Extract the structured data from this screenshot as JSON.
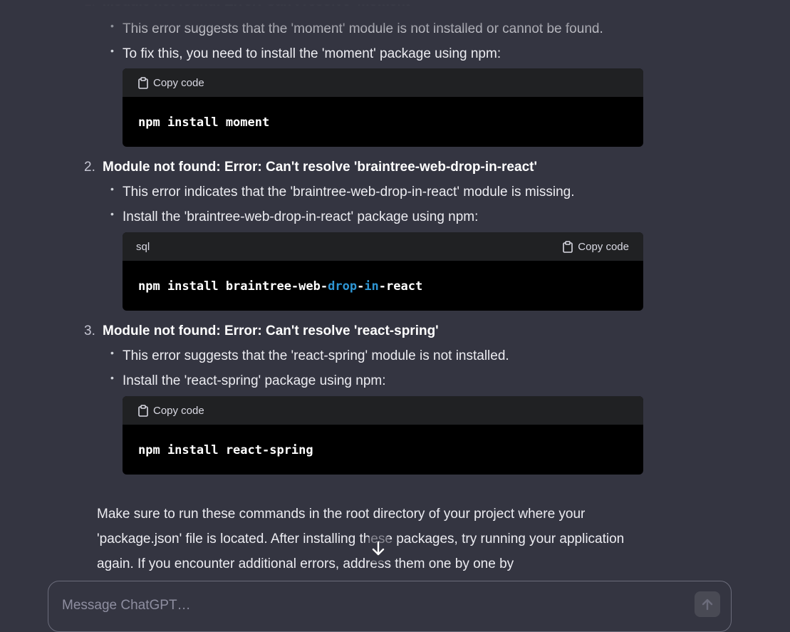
{
  "item1": {
    "number": "1.",
    "title": "Module not found: Error: Can't resolve 'moment'",
    "bullets": [
      "This error suggests that the 'moment' module is not installed or cannot be found.",
      "To fix this, you need to install the 'moment' package using npm:"
    ],
    "code": {
      "copy_label": "Copy code",
      "command": "npm install moment"
    }
  },
  "item2": {
    "number": "2.",
    "title": "Module not found: Error: Can't resolve 'braintree-web-drop-in-react'",
    "bullets": [
      "This error indicates that the 'braintree-web-drop-in-react' module is missing.",
      "Install the 'braintree-web-drop-in-react' package using npm:"
    ],
    "code": {
      "language": "sql",
      "copy_label": "Copy code",
      "parts": [
        "npm install braintree-web-",
        "drop",
        "-",
        "in",
        "-react"
      ]
    }
  },
  "item3": {
    "number": "3.",
    "title": "Module not found: Error: Can't resolve 'react-spring'",
    "bullets": [
      "This error suggests that the 'react-spring' module is not installed.",
      "Install the 'react-spring' package using npm:"
    ],
    "code": {
      "copy_label": "Copy code",
      "command": "npm install react-spring"
    }
  },
  "closing_paragraph": "Make sure to run these commands in the root directory of your project where your 'package.json' file is located. After installing these packages, try running your application again. If you encounter additional errors, address them one by one by",
  "composer": {
    "placeholder": "Message ChatGPT…"
  },
  "icons": {
    "copy": "clipboard-icon",
    "scroll": "arrow-down-icon",
    "send": "arrow-up-icon"
  },
  "colors": {
    "background": "#343541",
    "code_bg": "#000000",
    "code_header": "#202123",
    "keyword": "#2e95d3"
  }
}
